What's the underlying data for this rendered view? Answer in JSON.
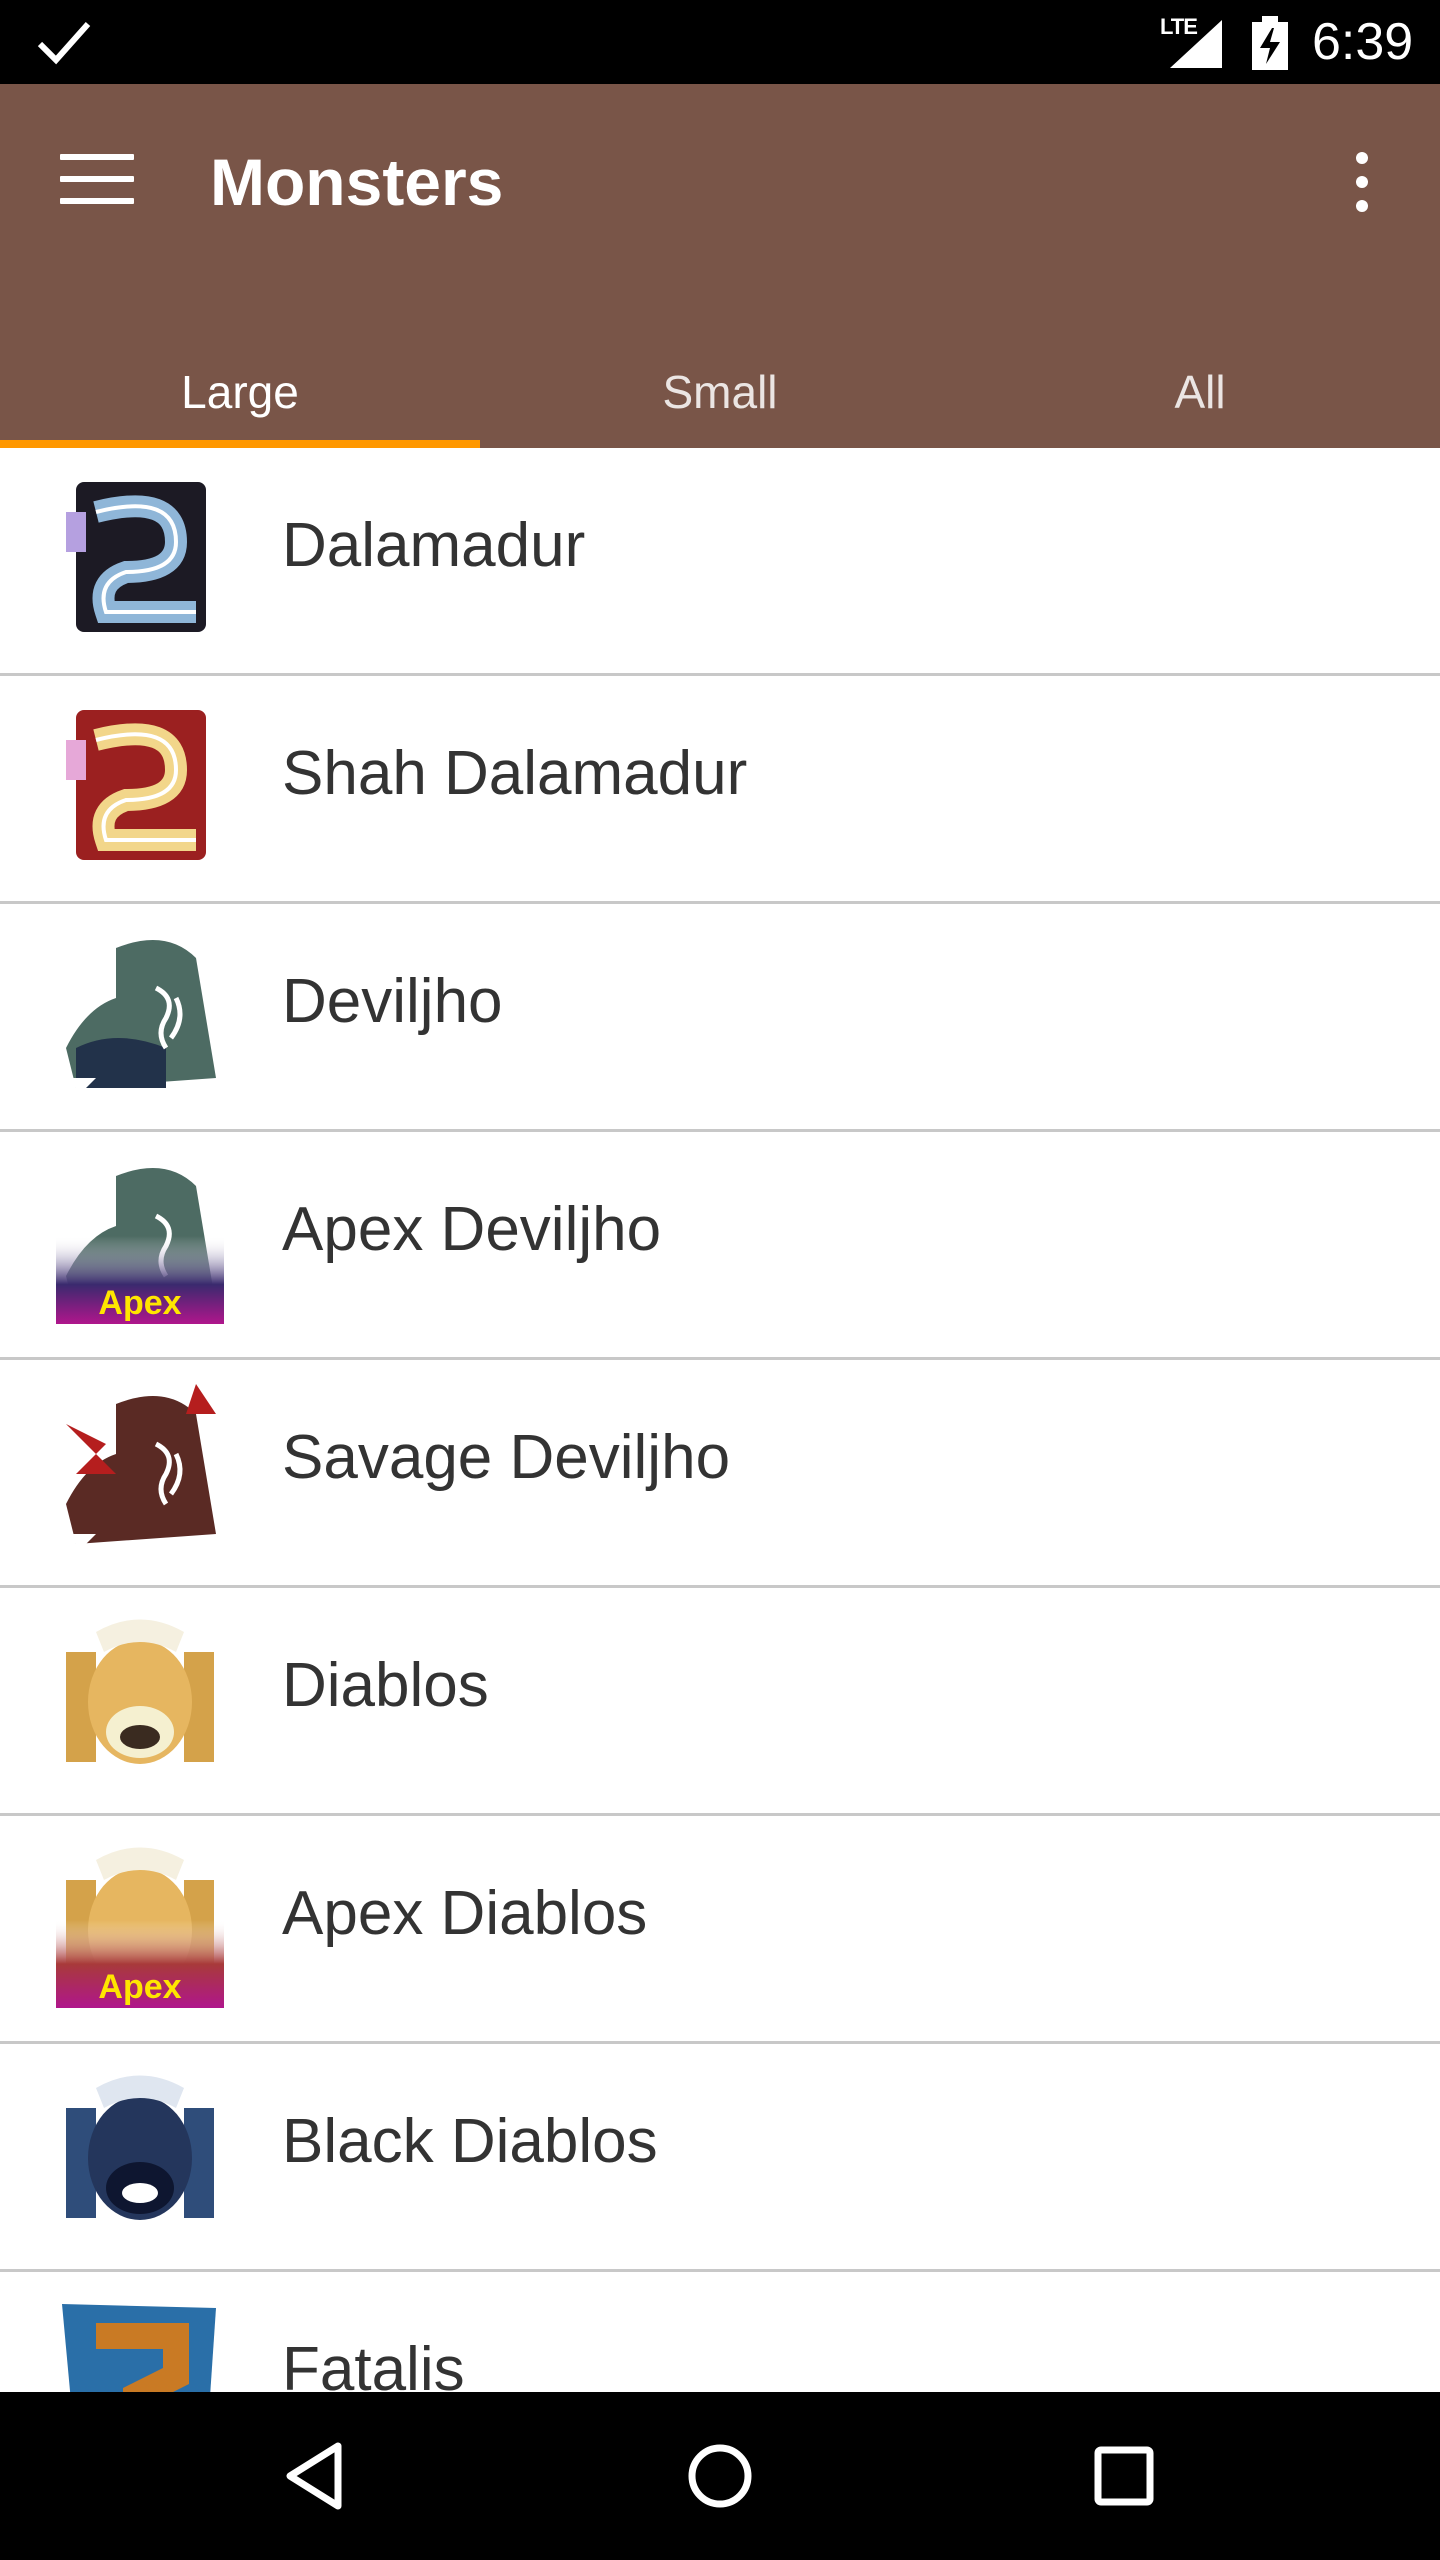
{
  "status_bar": {
    "network": "LTE",
    "time": "6:39",
    "icons": [
      "check-icon",
      "signal-icon",
      "battery-charging-icon"
    ]
  },
  "app_bar": {
    "title": "Monsters",
    "color": "#795548",
    "menu_icon": "menu-icon",
    "overflow_icon": "more-vert-icon"
  },
  "tabs": [
    {
      "label": "Large",
      "active": true
    },
    {
      "label": "Small",
      "active": false
    },
    {
      "label": "All",
      "active": false
    }
  ],
  "tab_indicator_color": "#FF9800",
  "monsters": [
    {
      "name": "Dalamadur",
      "icon": "dalamadur-icon"
    },
    {
      "name": "Shah Dalamadur",
      "icon": "shah-dalamadur-icon"
    },
    {
      "name": "Deviljho",
      "icon": "deviljho-icon"
    },
    {
      "name": "Apex Deviljho",
      "icon": "apex-deviljho-icon",
      "badge": "Apex"
    },
    {
      "name": "Savage Deviljho",
      "icon": "savage-deviljho-icon"
    },
    {
      "name": "Diablos",
      "icon": "diablos-icon"
    },
    {
      "name": "Apex Diablos",
      "icon": "apex-diablos-icon",
      "badge": "Apex"
    },
    {
      "name": "Black Diablos",
      "icon": "black-diablos-icon"
    },
    {
      "name": "Fatalis",
      "icon": "fatalis-icon"
    }
  ],
  "nav_bar": {
    "icons": [
      "back-icon",
      "home-icon",
      "recents-icon"
    ]
  }
}
